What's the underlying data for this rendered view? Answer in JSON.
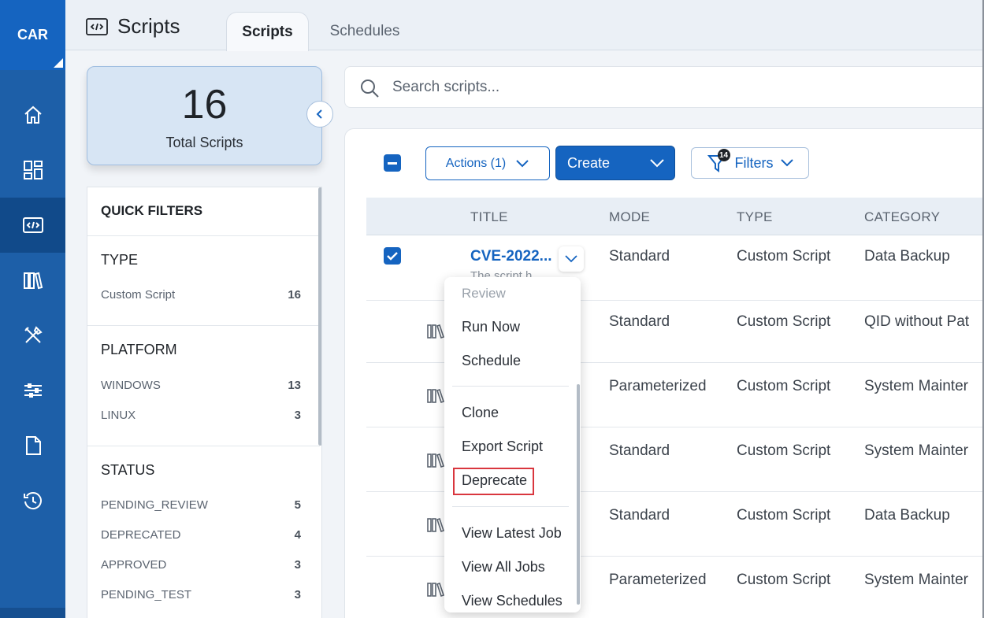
{
  "nav": {
    "brand": "CAR",
    "items": [
      "home-icon",
      "dashboard-icon",
      "scripts-icon",
      "library-icon",
      "tools-icon",
      "sliders-icon",
      "document-icon",
      "history-icon"
    ],
    "active": "scripts-icon"
  },
  "header": {
    "title": "Scripts",
    "tabs": [
      {
        "label": "Scripts",
        "active": true
      },
      {
        "label": "Schedules",
        "active": false
      }
    ]
  },
  "summary": {
    "count": "16",
    "label": "Total Scripts"
  },
  "quick_filters": {
    "heading": "QUICK FILTERS",
    "sections": [
      {
        "title": "TYPE",
        "items": [
          {
            "label": "Custom Script",
            "count": "16"
          }
        ]
      },
      {
        "title": "PLATFORM",
        "items": [
          {
            "label": "WINDOWS",
            "count": "13"
          },
          {
            "label": "LINUX",
            "count": "3"
          }
        ]
      },
      {
        "title": "STATUS",
        "items": [
          {
            "label": "PENDING_REVIEW",
            "count": "5"
          },
          {
            "label": "DEPRECATED",
            "count": "4"
          },
          {
            "label": "APPROVED",
            "count": "3"
          },
          {
            "label": "PENDING_TEST",
            "count": "3"
          }
        ]
      }
    ]
  },
  "search": {
    "placeholder": "Search scripts..."
  },
  "toolbar": {
    "actions_label": "Actions (1)",
    "create_label": "Create",
    "filters_label": "Filters",
    "filters_badge": "14"
  },
  "table": {
    "columns": [
      "TITLE",
      "MODE",
      "TYPE",
      "CATEGORY"
    ],
    "rows": [
      {
        "title": "CVE-2022...",
        "desc": "The script h",
        "mode": "Standard",
        "type": "Custom Script",
        "category": "Data Backup",
        "checked": true
      },
      {
        "title": "",
        "desc": "",
        "mode": "Standard",
        "type": "Custom Script",
        "category": "QID without Pat",
        "checked": false
      },
      {
        "title": "",
        "desc": "",
        "mode": "Parameterized",
        "type": "Custom Script",
        "category": "System Mainter",
        "checked": false
      },
      {
        "title": "",
        "desc": "",
        "mode": "Standard",
        "type": "Custom Script",
        "category": "System Mainter",
        "checked": false
      },
      {
        "title": "",
        "desc": "",
        "mode": "Standard",
        "type": "Custom Script",
        "category": "Data Backup",
        "checked": false
      },
      {
        "title": "",
        "desc": "",
        "mode": "Parameterized",
        "type": "Custom Script",
        "category": "System Mainter",
        "checked": false
      }
    ]
  },
  "context_menu": {
    "items": [
      {
        "label": "Review",
        "disabled": true
      },
      {
        "label": "Run Now"
      },
      {
        "label": "Schedule"
      },
      {
        "label": "Clone"
      },
      {
        "label": "Export Script"
      },
      {
        "label": "Deprecate",
        "highlighted": true
      },
      {
        "label": "View Latest Job"
      },
      {
        "label": "View All Jobs"
      },
      {
        "label": "View Schedules"
      }
    ],
    "highlight_color": "#d9363e"
  },
  "colors": {
    "primary": "#1564c0",
    "rail": "#1d5fa8",
    "rail_active": "#114a8a"
  }
}
